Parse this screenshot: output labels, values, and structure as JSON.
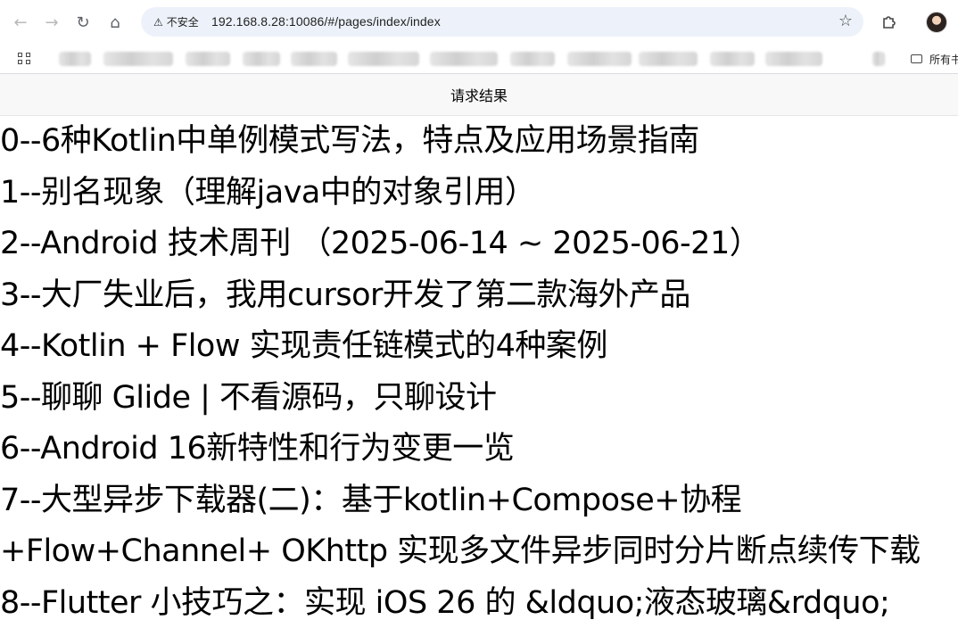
{
  "browser": {
    "nav": {
      "back_icon": "←",
      "forward_icon": "→",
      "reload_icon": "↻",
      "home_icon": "⌂"
    },
    "omnibox": {
      "security_label": "不安全",
      "url": "192.168.8.28:10086/#/pages/index/index"
    },
    "bookmarks_folder_label": "所有书"
  },
  "page": {
    "request_bar_label": "请求结果",
    "results": [
      "0--6种Kotlin中单例模式写法，特点及应用场景指南",
      "1--别名现象（理解java中的对象引用）",
      "2--Android 技术周刊 （2025-06-14 ~ 2025-06-21）",
      "3--大厂失业后，我用cursor开发了第二款海外产品",
      "4--Kotlin + Flow 实现责任链模式的4种案例",
      "5--聊聊 Glide | 不看源码，只聊设计",
      "6--Android 16新特性和行为变更一览",
      "7--大型异步下载器(二)：基于kotlin+Compose+协程",
      "+Flow+Channel+ OKhttp 实现多文件异步同时分片断点续传下载",
      "8--Flutter 小技巧之：实现 iOS 26 的 &ldquo;液态玻璃&rdquo;"
    ]
  }
}
